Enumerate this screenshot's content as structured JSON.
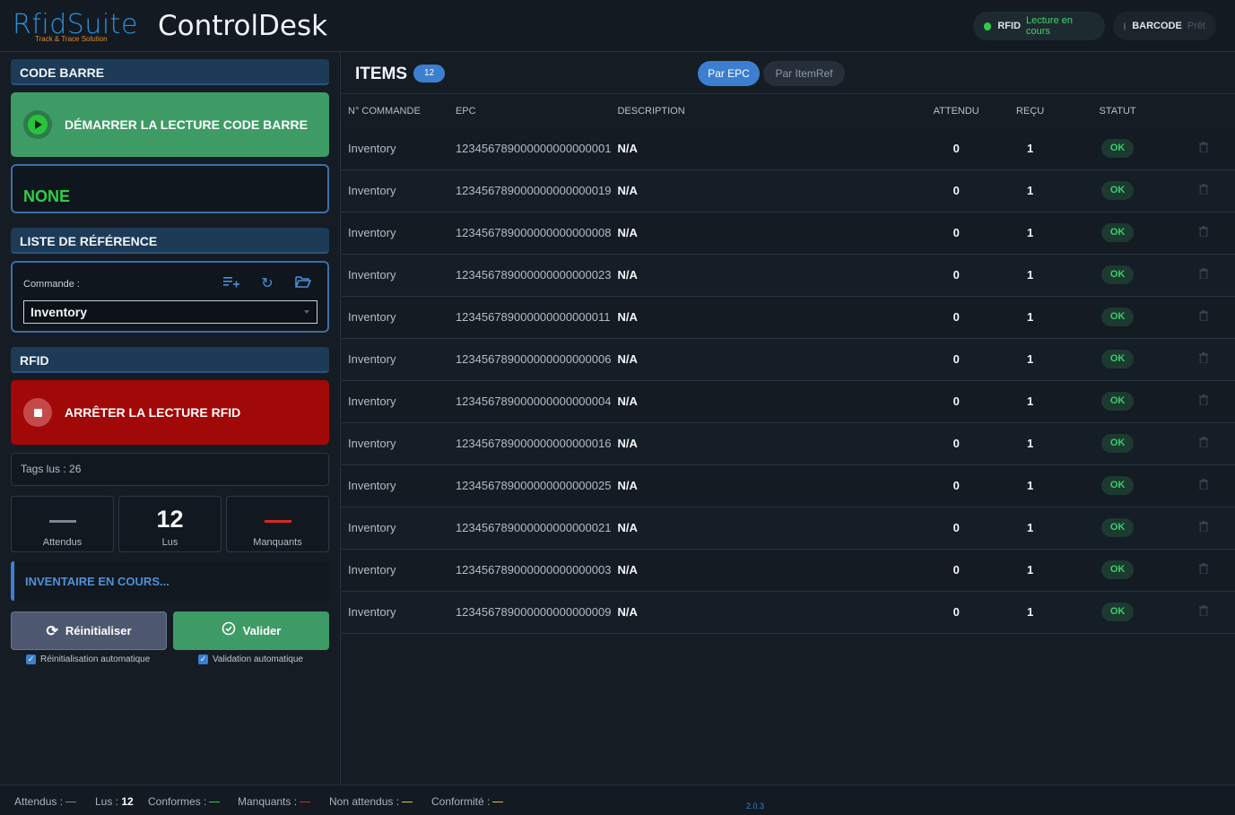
{
  "header": {
    "logo_main": "RfidSuite",
    "logo_sub": "Track & Trace Solution",
    "app_title": "ControlDesk",
    "rfid_pill": {
      "label": "RFID",
      "status": "Lecture en cours",
      "dot_color": "#2fcf45"
    },
    "barcode_pill": {
      "label": "BARCODE",
      "status": "Prêt",
      "dot_color": "#4c5561"
    }
  },
  "left": {
    "barcode_section": "CODE BARRE",
    "barcode_button": "DÉMARRER LA LECTURE CODE BARRE",
    "barcode_value": "NONE",
    "ref_section": "LISTE DE RÉFÉRENCE",
    "ref_label": "Commande :",
    "ref_selected": "Inventory",
    "rfid_section": "RFID",
    "rfid_button": "ARRÊTER LA LECTURE RFID",
    "tags_read": "Tags lus : 26",
    "stats": {
      "expected": {
        "value": "",
        "label": "Attendus",
        "dash_color": "#7b858f"
      },
      "read": {
        "value": "12",
        "label": "Lus"
      },
      "missing": {
        "value": "",
        "label": "Manquants",
        "dash_color": "#d62828"
      }
    },
    "status_text": "INVENTAIRE EN COURS...",
    "reset_button": "Réinitialiser",
    "validate_button": "Valider",
    "auto_reset_label": "Réinitialisation automatique",
    "auto_validate_label": "Validation automatique"
  },
  "items": {
    "title": "ITEMS",
    "count": "12",
    "tabs": [
      "Par EPC",
      "Par ItemRef"
    ],
    "columns": [
      "N° COMMANDE",
      "EPC",
      "DESCRIPTION",
      "ATTENDU",
      "REÇU",
      "STATUT"
    ],
    "rows": [
      {
        "cmd": "Inventory",
        "epc": "123456789000000000000001",
        "desc": "N/A",
        "expected": "0",
        "received": "1",
        "status": "OK"
      },
      {
        "cmd": "Inventory",
        "epc": "123456789000000000000019",
        "desc": "N/A",
        "expected": "0",
        "received": "1",
        "status": "OK"
      },
      {
        "cmd": "Inventory",
        "epc": "123456789000000000000008",
        "desc": "N/A",
        "expected": "0",
        "received": "1",
        "status": "OK"
      },
      {
        "cmd": "Inventory",
        "epc": "123456789000000000000023",
        "desc": "N/A",
        "expected": "0",
        "received": "1",
        "status": "OK"
      },
      {
        "cmd": "Inventory",
        "epc": "123456789000000000000011",
        "desc": "N/A",
        "expected": "0",
        "received": "1",
        "status": "OK"
      },
      {
        "cmd": "Inventory",
        "epc": "123456789000000000000006",
        "desc": "N/A",
        "expected": "0",
        "received": "1",
        "status": "OK"
      },
      {
        "cmd": "Inventory",
        "epc": "123456789000000000000004",
        "desc": "N/A",
        "expected": "0",
        "received": "1",
        "status": "OK"
      },
      {
        "cmd": "Inventory",
        "epc": "123456789000000000000016",
        "desc": "N/A",
        "expected": "0",
        "received": "1",
        "status": "OK"
      },
      {
        "cmd": "Inventory",
        "epc": "123456789000000000000025",
        "desc": "N/A",
        "expected": "0",
        "received": "1",
        "status": "OK"
      },
      {
        "cmd": "Inventory",
        "epc": "123456789000000000000021",
        "desc": "N/A",
        "expected": "0",
        "received": "1",
        "status": "OK"
      },
      {
        "cmd": "Inventory",
        "epc": "123456789000000000000003",
        "desc": "N/A",
        "expected": "0",
        "received": "1",
        "status": "OK"
      },
      {
        "cmd": "Inventory",
        "epc": "123456789000000000000009",
        "desc": "N/A",
        "expected": "0",
        "received": "1",
        "status": "OK"
      }
    ]
  },
  "footer": {
    "expected_label": "Attendus :",
    "read_label": "Lus :",
    "read_value": "12",
    "conform_label": "Conformes :",
    "missing_label": "Manquants :",
    "unexpected_label": "Non attendus :",
    "conformity_label": "Conformité :",
    "version": "2.0.3",
    "dash_colors": {
      "expected": "#7b858f",
      "conform": "#2fcf45",
      "missing": "#d62828",
      "unexpected": "#e6c229",
      "conformity": "#e6c229"
    }
  }
}
